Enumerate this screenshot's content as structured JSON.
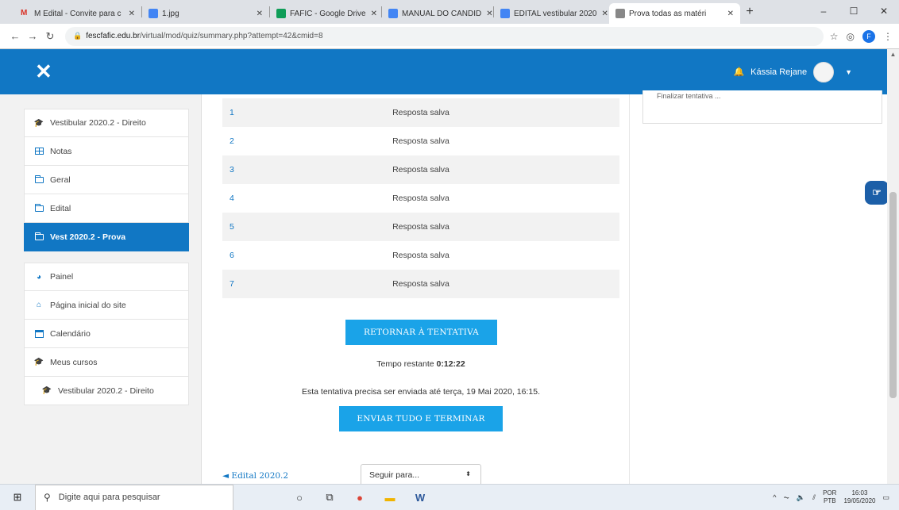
{
  "browser": {
    "tabs": [
      {
        "title": "M Edital - Convite para c",
        "favicon_color": "#d93025"
      },
      {
        "title": "1.jpg",
        "favicon_color": "#4285f4"
      },
      {
        "title": "FAFIC - Google Drive",
        "favicon_color": "#0f9d58"
      },
      {
        "title": "MANUAL DO CANDID",
        "favicon_color": "#4285f4"
      },
      {
        "title": "EDITAL vestibular 2020",
        "favicon_color": "#4285f4"
      },
      {
        "title": "Prova todas as matéri",
        "favicon_color": "#888888",
        "active": true
      }
    ],
    "url_host": "fescfafic.edu.br",
    "url_path": "/virtual/mod/quiz/summary.php?attempt=42&cmid=8",
    "profile_initial": "F"
  },
  "header": {
    "user_name": "Kássia Rejane",
    "accent": "#1177c4"
  },
  "sidebar": {
    "course_top": "Vestibular 2020.2 - Direito",
    "items": [
      {
        "label": "Notas",
        "icon": "grid-icon"
      },
      {
        "label": "Geral",
        "icon": "folder-icon"
      },
      {
        "label": "Edital",
        "icon": "folder-icon"
      },
      {
        "label": "Vest 2020.2 - Prova",
        "icon": "folder-icon",
        "active": true
      }
    ],
    "group2": [
      {
        "label": "Painel",
        "icon": "dashboard-icon"
      },
      {
        "label": "Página inicial do site",
        "icon": "home-icon"
      },
      {
        "label": "Calendário",
        "icon": "calendar-icon"
      },
      {
        "label": "Meus cursos",
        "icon": "graduation-cap-icon"
      },
      {
        "label": "Vestibular 2020.2 - Direito",
        "icon": "graduation-cap-icon"
      }
    ]
  },
  "summary": {
    "rows": [
      {
        "num": "1",
        "status": "Resposta salva"
      },
      {
        "num": "2",
        "status": "Resposta salva"
      },
      {
        "num": "3",
        "status": "Resposta salva"
      },
      {
        "num": "4",
        "status": "Resposta salva"
      },
      {
        "num": "5",
        "status": "Resposta salva"
      },
      {
        "num": "6",
        "status": "Resposta salva"
      },
      {
        "num": "7",
        "status": "Resposta salva"
      }
    ],
    "return_button": "RETORNAR À TENTATIVA",
    "timer_label": "Tempo restante",
    "timer_value": "0:12:22",
    "deadline_text": "Esta tentativa precisa ser enviada até terça, 19 Mai 2020, 16:15.",
    "submit_button": "ENVIAR TUDO E TERMINAR",
    "prev_link": "◄ Edital 2020.2",
    "jump_placeholder": "Seguir para..."
  },
  "right_block": {
    "finish_link": "Finalizar tentativa ..."
  },
  "taskbar": {
    "search_placeholder": "Digite aqui para pesquisar",
    "lang_top": "POR",
    "lang_bottom": "PTB",
    "time": "16:03",
    "date": "19/05/2020"
  }
}
